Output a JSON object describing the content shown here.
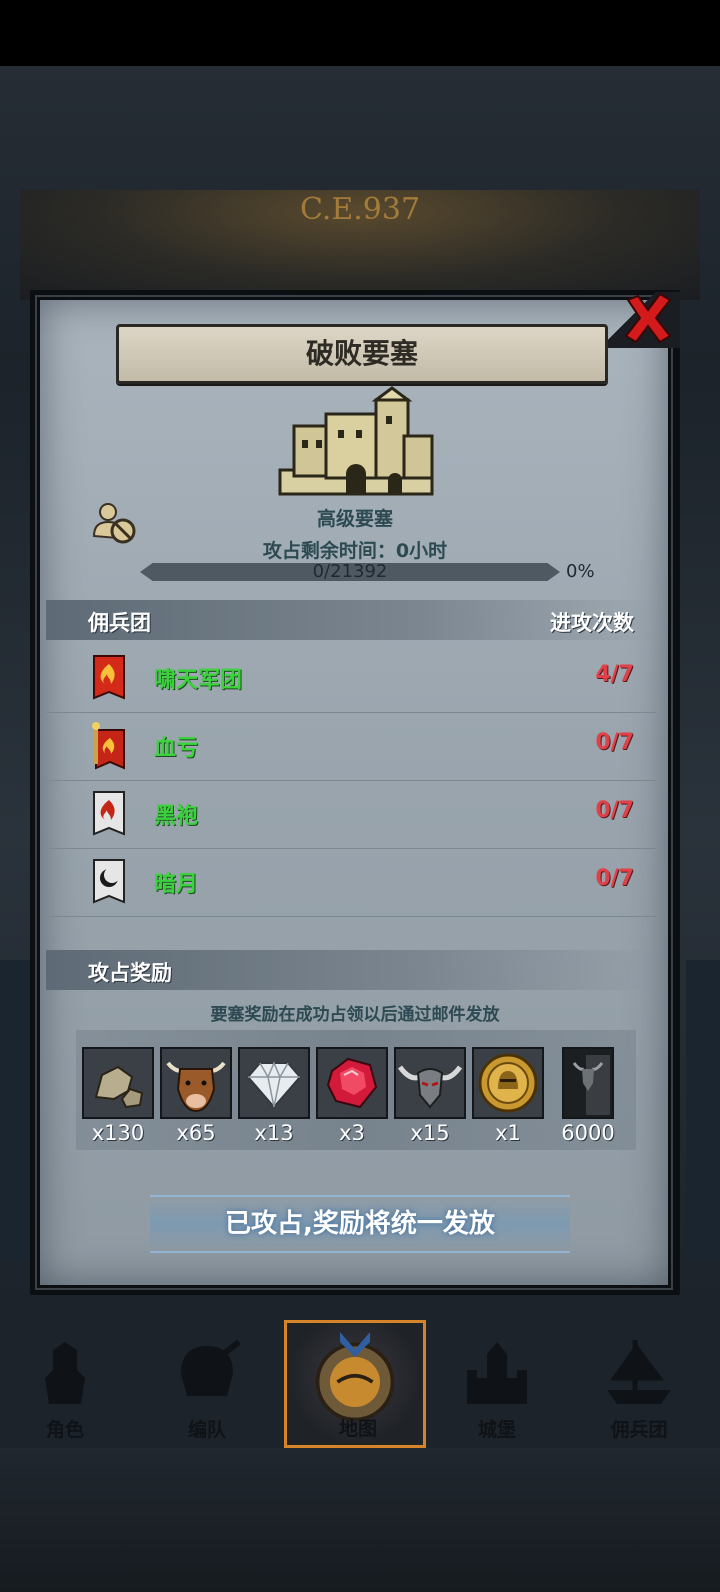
{
  "header": {
    "era": "C.E.937"
  },
  "dialog": {
    "title": "破败要塞",
    "fort_type": "高级要塞",
    "remaining_time": "攻占剩余时间：0小时",
    "progress": {
      "text": "0/21392",
      "percent": "0%",
      "fraction": 0
    },
    "legion_section": {
      "label": "佣兵团",
      "attack_count_label": "进攻次数"
    },
    "legions": [
      {
        "name": "啸天军团",
        "count": "4/7",
        "icon": "flame-banner-icon",
        "color": "#d42a1a"
      },
      {
        "name": "血亏",
        "count": "0/7",
        "icon": "torch-banner-icon",
        "color": "#c42516"
      },
      {
        "name": "黑袍",
        "count": "0/7",
        "icon": "white-flame-banner-icon",
        "color": "#e6e6e6"
      },
      {
        "name": "暗月",
        "count": "0/7",
        "icon": "crescent-moon-banner-icon",
        "color": "#e6e6e6"
      }
    ],
    "reward_section": {
      "label": "攻占奖励",
      "note": "要塞奖励在成功占领以后通过邮件发放"
    },
    "rewards": [
      {
        "icon": "stone-icon",
        "qty": "x130"
      },
      {
        "icon": "ox-icon",
        "qty": "x65"
      },
      {
        "icon": "diamond-icon",
        "qty": "x13"
      },
      {
        "icon": "ruby-icon",
        "qty": "x3"
      },
      {
        "icon": "horned-helmet-icon",
        "qty": "x15"
      },
      {
        "icon": "gold-medal-icon",
        "qty": "x1"
      },
      {
        "icon": "legion-honor-icon",
        "qty": "6000"
      }
    ],
    "claimed_label": "已攻占,奖励将统一发放"
  },
  "nav": {
    "items": [
      {
        "label": "角色",
        "icon": "knight-icon"
      },
      {
        "label": "编队",
        "icon": "helmet-icon"
      },
      {
        "label": "地图",
        "icon": "map-emblem-icon",
        "active": true
      },
      {
        "label": "城堡",
        "icon": "castle-icon"
      },
      {
        "label": "佣兵团",
        "icon": "ship-icon"
      }
    ]
  },
  "colors": {
    "legion_name": "#3cd23e",
    "attack_count": "#e04048",
    "nav_active": "#d58428"
  }
}
